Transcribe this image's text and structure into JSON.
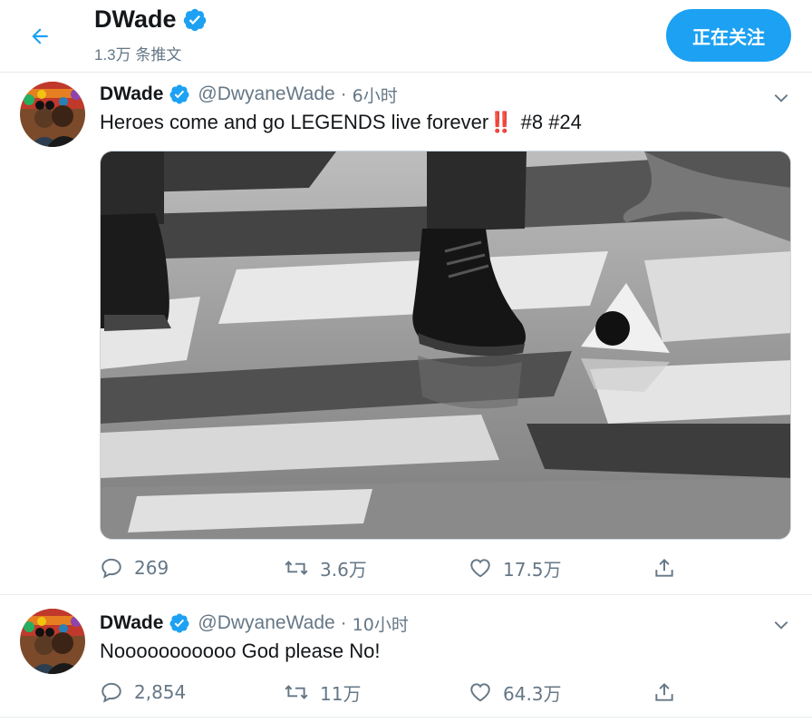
{
  "header": {
    "name": "DWade",
    "tweet_count": "1.3万 条推文",
    "follow_label": "正在关注"
  },
  "colors": {
    "accent": "#1da1f2",
    "text": "#14171a",
    "muted": "#657786",
    "border": "#e6ecf0"
  },
  "tweets": [
    {
      "name": "DWade",
      "handle": "@DwyaneWade",
      "sep": "·",
      "time": "6小时",
      "text": "Heroes come and go LEGENDS live forever",
      "emoji": "‼️",
      "tags": "#8 #24",
      "media": "black-and-white photo of dress shoes on basketball court beside a ball on a stand",
      "replies": "269",
      "retweets": "3.6万",
      "likes": "17.5万"
    },
    {
      "name": "DWade",
      "handle": "@DwyaneWade",
      "sep": "·",
      "time": "10小时",
      "text": "Nooooooooooo God please No!",
      "replies": "2,854",
      "retweets": "11万",
      "likes": "64.3万"
    }
  ]
}
